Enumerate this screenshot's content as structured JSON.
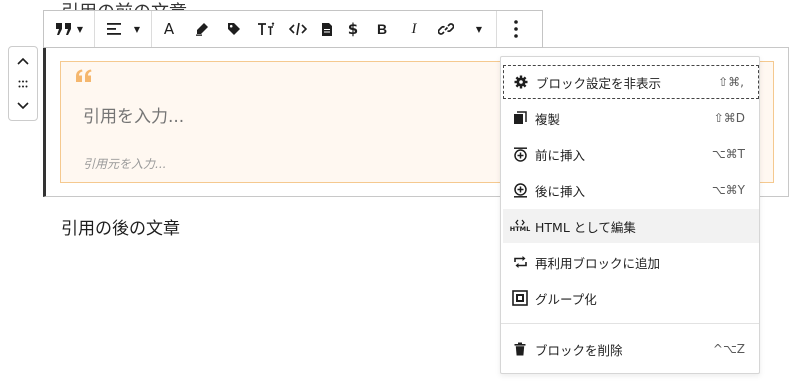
{
  "editor": {
    "above_text": "引用の前の文章",
    "quote_placeholder": "引用を入力...",
    "citation_placeholder": "引用元を入力...",
    "after_text": "引用の後の文章"
  },
  "colors": {
    "quote_bg": "#fff8f1",
    "quote_border": "#f5c98f",
    "quote_mark": "#f5b76e",
    "menu_hover": "#f2f2f2"
  },
  "toolbar": {
    "buttons": [
      "quote-transform",
      "align",
      "text-color",
      "highlight",
      "tag",
      "font-size",
      "code",
      "document",
      "dollar",
      "bold",
      "italic",
      "link",
      "more-rich-text",
      "more-options"
    ],
    "bold_label": "B",
    "italic_label": "I",
    "text_color_label": "A"
  },
  "menu": {
    "items": [
      {
        "label": "ブロック設定を非表示",
        "shortcut": "⇧⌘,",
        "icon": "gear-icon"
      },
      {
        "label": "複製",
        "shortcut": "⇧⌘D",
        "icon": "copy-icon"
      },
      {
        "label": "前に挿入",
        "shortcut": "⌥⌘T",
        "icon": "insert-before-icon"
      },
      {
        "label": "後に挿入",
        "shortcut": "⌥⌘Y",
        "icon": "insert-after-icon"
      },
      {
        "label": "HTML として編集",
        "shortcut": "",
        "icon": "html-icon"
      },
      {
        "label": "再利用ブロックに追加",
        "shortcut": "",
        "icon": "reusable-icon"
      },
      {
        "label": "グループ化",
        "shortcut": "",
        "icon": "group-icon"
      },
      {
        "label": "ブロックを削除",
        "shortcut": "^⌥Z",
        "icon": "trash-icon"
      }
    ],
    "html_icon_text": "HTML"
  }
}
